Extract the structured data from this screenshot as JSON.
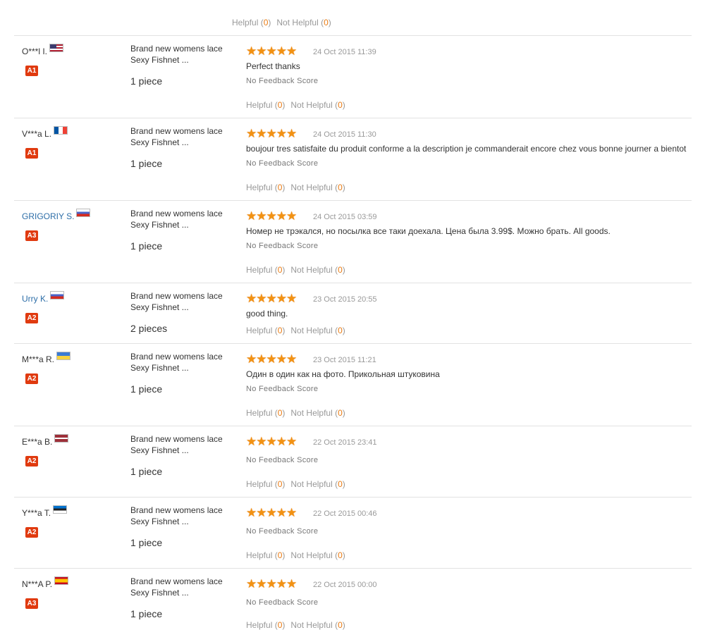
{
  "colors": {
    "accent_orange": "#f29213",
    "badge_red": "#e03a0f",
    "link_blue": "#2d6ea8",
    "divider": "#e2e2e2"
  },
  "top_actions": {
    "helpful_label": "Helpful",
    "helpful_count": "0",
    "not_helpful_label": "Not Helpful",
    "not_helpful_count": "0"
  },
  "reviews": [
    {
      "user": "O***l I.",
      "flag_icon": "us-flag-icon",
      "level": "A1",
      "product": "Brand new womens lace Sexy Fishnet ...",
      "quantity": "1 piece",
      "rating": 5,
      "stars": "★★★★★",
      "date": "24 Oct 2015 11:39",
      "text": "Perfect thanks",
      "feedback_score": "No Feedback Score",
      "helpful_label": "Helpful",
      "helpful_count": "0",
      "not_helpful_label": "Not Helpful",
      "not_helpful_count": "0"
    },
    {
      "user": "V***a L.",
      "flag_icon": "fr-flag-icon",
      "level": "A1",
      "product": "Brand new womens lace Sexy Fishnet ...",
      "quantity": "1 piece",
      "rating": 5,
      "stars": "★★★★★",
      "date": "24 Oct 2015 11:30",
      "text": "boujour tres satisfaite du produit conforme a la description je commanderait encore chez vous bonne journer a bientot",
      "feedback_score": "No Feedback Score",
      "helpful_label": "Helpful",
      "helpful_count": "0",
      "not_helpful_label": "Not Helpful",
      "not_helpful_count": "0"
    },
    {
      "user": "GRIGORIY S.",
      "flag_icon": "ru-flag-icon",
      "level": "A3",
      "product": "Brand new womens lace Sexy Fishnet ...",
      "quantity": "1 piece",
      "rating": 5,
      "stars": "★★★★★",
      "date": "24 Oct 2015 03:59",
      "text": "Номер не трэкался, но посылка все таки доехала. Цена была 3.99$. Можно брать. All goods.",
      "feedback_score": "No Feedback Score",
      "helpful_label": "Helpful",
      "helpful_count": "0",
      "not_helpful_label": "Not Helpful",
      "not_helpful_count": "0"
    },
    {
      "user": "Urry K.",
      "flag_icon": "ru-flag-icon",
      "level": "A2",
      "product": "Brand new womens lace Sexy Fishnet ...",
      "quantity": "2 pieces",
      "rating": 5,
      "stars": "★★★★★",
      "date": "23 Oct 2015 20:55",
      "text": "good thing.",
      "feedback_score": "",
      "helpful_label": "Helpful",
      "helpful_count": "0",
      "not_helpful_label": "Not Helpful",
      "not_helpful_count": "0"
    },
    {
      "user": "M***a R.",
      "flag_icon": "ua-flag-icon",
      "level": "A2",
      "product": "Brand new womens lace Sexy Fishnet ...",
      "quantity": "1 piece",
      "rating": 5,
      "stars": "★★★★★",
      "date": "23 Oct 2015 11:21",
      "text": "Один в один как на фото. Прикольная штуковина",
      "feedback_score": "No Feedback Score",
      "helpful_label": "Helpful",
      "helpful_count": "0",
      "not_helpful_label": "Not Helpful",
      "not_helpful_count": "0"
    },
    {
      "user": "E***a B.",
      "flag_icon": "lv-flag-icon",
      "level": "A2",
      "product": "Brand new womens lace Sexy Fishnet ...",
      "quantity": "1 piece",
      "rating": 5,
      "stars": "★★★★★",
      "date": "22 Oct 2015 23:41",
      "text": "",
      "feedback_score": "No Feedback Score",
      "helpful_label": "Helpful",
      "helpful_count": "0",
      "not_helpful_label": "Not Helpful",
      "not_helpful_count": "0"
    },
    {
      "user": "Y***a T.",
      "flag_icon": "ee-flag-icon",
      "level": "A2",
      "product": "Brand new womens lace Sexy Fishnet ...",
      "quantity": "1 piece",
      "rating": 5,
      "stars": "★★★★★",
      "date": "22 Oct 2015 00:46",
      "text": "",
      "feedback_score": "No Feedback Score",
      "helpful_label": "Helpful",
      "helpful_count": "0",
      "not_helpful_label": "Not Helpful",
      "not_helpful_count": "0"
    },
    {
      "user": "N***A P.",
      "flag_icon": "es-flag-icon",
      "level": "A3",
      "product": "Brand new womens lace Sexy Fishnet ...",
      "quantity": "1 piece",
      "rating": 5,
      "stars": "★★★★★",
      "date": "22 Oct 2015 00:00",
      "text": "",
      "feedback_score": "No Feedback Score",
      "helpful_label": "Helpful",
      "helpful_count": "0",
      "not_helpful_label": "Not Helpful",
      "not_helpful_count": "0"
    }
  ]
}
